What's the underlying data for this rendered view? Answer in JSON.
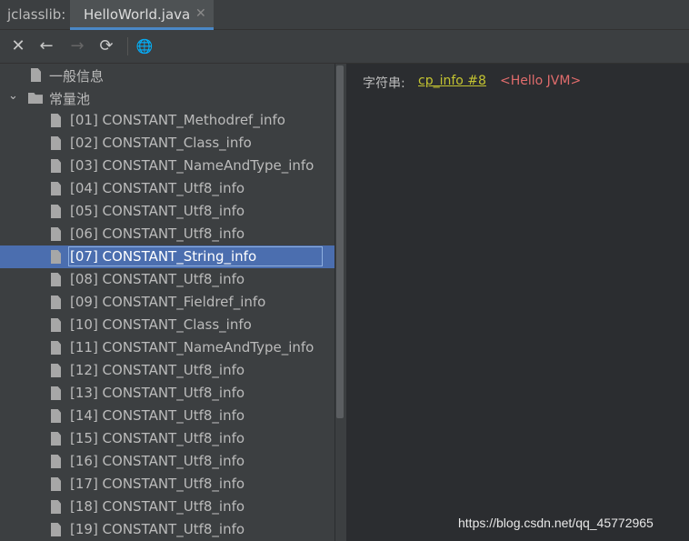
{
  "tool_label": "jclasslib:",
  "tab": {
    "label": "HelloWorld.java",
    "close": "✕"
  },
  "toolbar": {
    "close": "✕",
    "back": "←",
    "forward": "→",
    "refresh": "⟳",
    "browse": "🌐"
  },
  "tree": {
    "general_info": "一般信息",
    "constant_pool": "常量池",
    "items": [
      "[01] CONSTANT_Methodref_info",
      "[02] CONSTANT_Class_info",
      "[03] CONSTANT_NameAndType_info",
      "[04] CONSTANT_Utf8_info",
      "[05] CONSTANT_Utf8_info",
      "[06] CONSTANT_Utf8_info",
      "[07] CONSTANT_String_info",
      "[08] CONSTANT_Utf8_info",
      "[09] CONSTANT_Fieldref_info",
      "[10] CONSTANT_Class_info",
      "[11] CONSTANT_NameAndType_info",
      "[12] CONSTANT_Utf8_info",
      "[13] CONSTANT_Utf8_info",
      "[14] CONSTANT_Utf8_info",
      "[15] CONSTANT_Utf8_info",
      "[16] CONSTANT_Utf8_info",
      "[17] CONSTANT_Utf8_info",
      "[18] CONSTANT_Utf8_info",
      "[19] CONSTANT_Utf8_info"
    ],
    "selected_index": 6
  },
  "detail": {
    "label": "字符串:",
    "link": "cp_info #8",
    "value": "<Hello JVM>"
  },
  "watermark": "https://blog.csdn.net/qq_45772965",
  "colors": {
    "accent": "#4a88c7",
    "selected_row": "#4b6eaf",
    "link": "#c4c431",
    "value": "#e06c6c"
  }
}
